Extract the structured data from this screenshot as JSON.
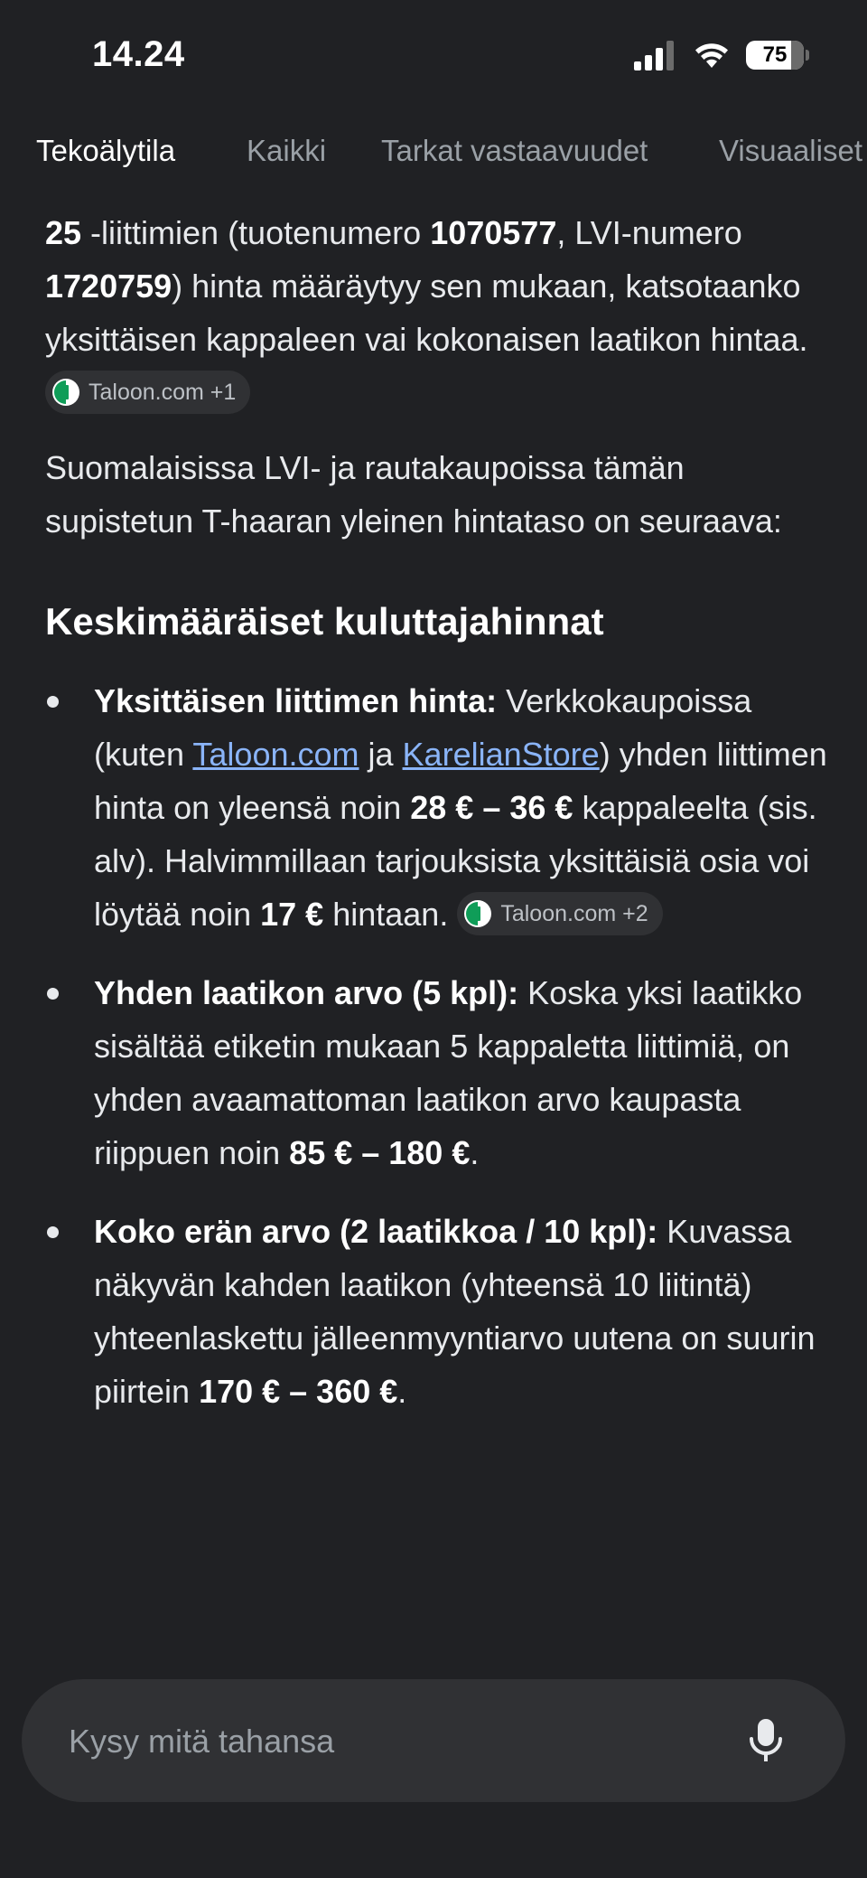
{
  "status_bar": {
    "time": "14.24",
    "battery_level": "75"
  },
  "tabs": [
    {
      "label": "Tekoälytila",
      "active": true
    },
    {
      "label": "Kaikki",
      "active": false
    },
    {
      "label": "Tarkat vastaavuudet",
      "active": false
    },
    {
      "label": "Visuaaliset",
      "active": false
    }
  ],
  "content": {
    "intro": {
      "p1": "25",
      "p2": " -liittimien (tuotenumero ",
      "p3": "1070577",
      "p4": ", LVI-numero ",
      "p5": "1720759",
      "p6": ") hinta määräytyy sen mukaan, katsotaanko yksittäisen kappaleen vai kokonaisen laatikon hintaa. ",
      "source": "Taloon.com +1"
    },
    "para2": "Suomalaisissa LVI- ja rautakaupoissa tämän supistetun T-haaran yleinen hintataso on seuraava:",
    "heading": "Keskimääräiset kuluttajahinnat",
    "bullets": {
      "b1": {
        "title": "Yksittäisen liittimen hinta:",
        "t1": " Verkkokaupoissa (kuten ",
        "link1": "Taloon.com",
        "t2": " ja ",
        "link2": "KarelianStore",
        "t3": ") yhden liittimen hinta on yleensä noin ",
        "b_price": "28 € – 36 €",
        "t4": " kappaleelta (sis. alv). Halvimmillaan tarjouksista yksittäisiä osia voi löytää noin ",
        "b_price2": "17 €",
        "t5": " hintaan. ",
        "source": "Taloon.com +2"
      },
      "b2": {
        "title": "Yhden laatikon arvo (5 kpl):",
        "t1": " Koska yksi laatikko sisältää etiketin mukaan 5 kappaletta liittimiä, on yhden avaamattoman laatikon arvo kaupasta riippuen noin ",
        "b_price": "85 € – 180 €",
        "t2": "."
      },
      "b3": {
        "title": "Koko erän arvo (2 laatikkoa / 10 kpl):",
        "t1": " Kuvassa näkyvän kahden laatikon (yhteensä 10 liitintä) yhteenlaskettu jälleenmyyntiarvo uutena on suurin piirtein ",
        "b_price": "170 € – 360 €",
        "t2": "."
      }
    }
  },
  "ask_bar": {
    "placeholder": "Kysy mitä tahansa",
    "mic_icon": "mic-icon"
  },
  "colors": {
    "background": "#202124",
    "text": "#e8eaed",
    "link": "#8ab4f8",
    "chip_bg": "#303134",
    "muted": "#9aa0a6",
    "source_green": "#0f9d58"
  }
}
